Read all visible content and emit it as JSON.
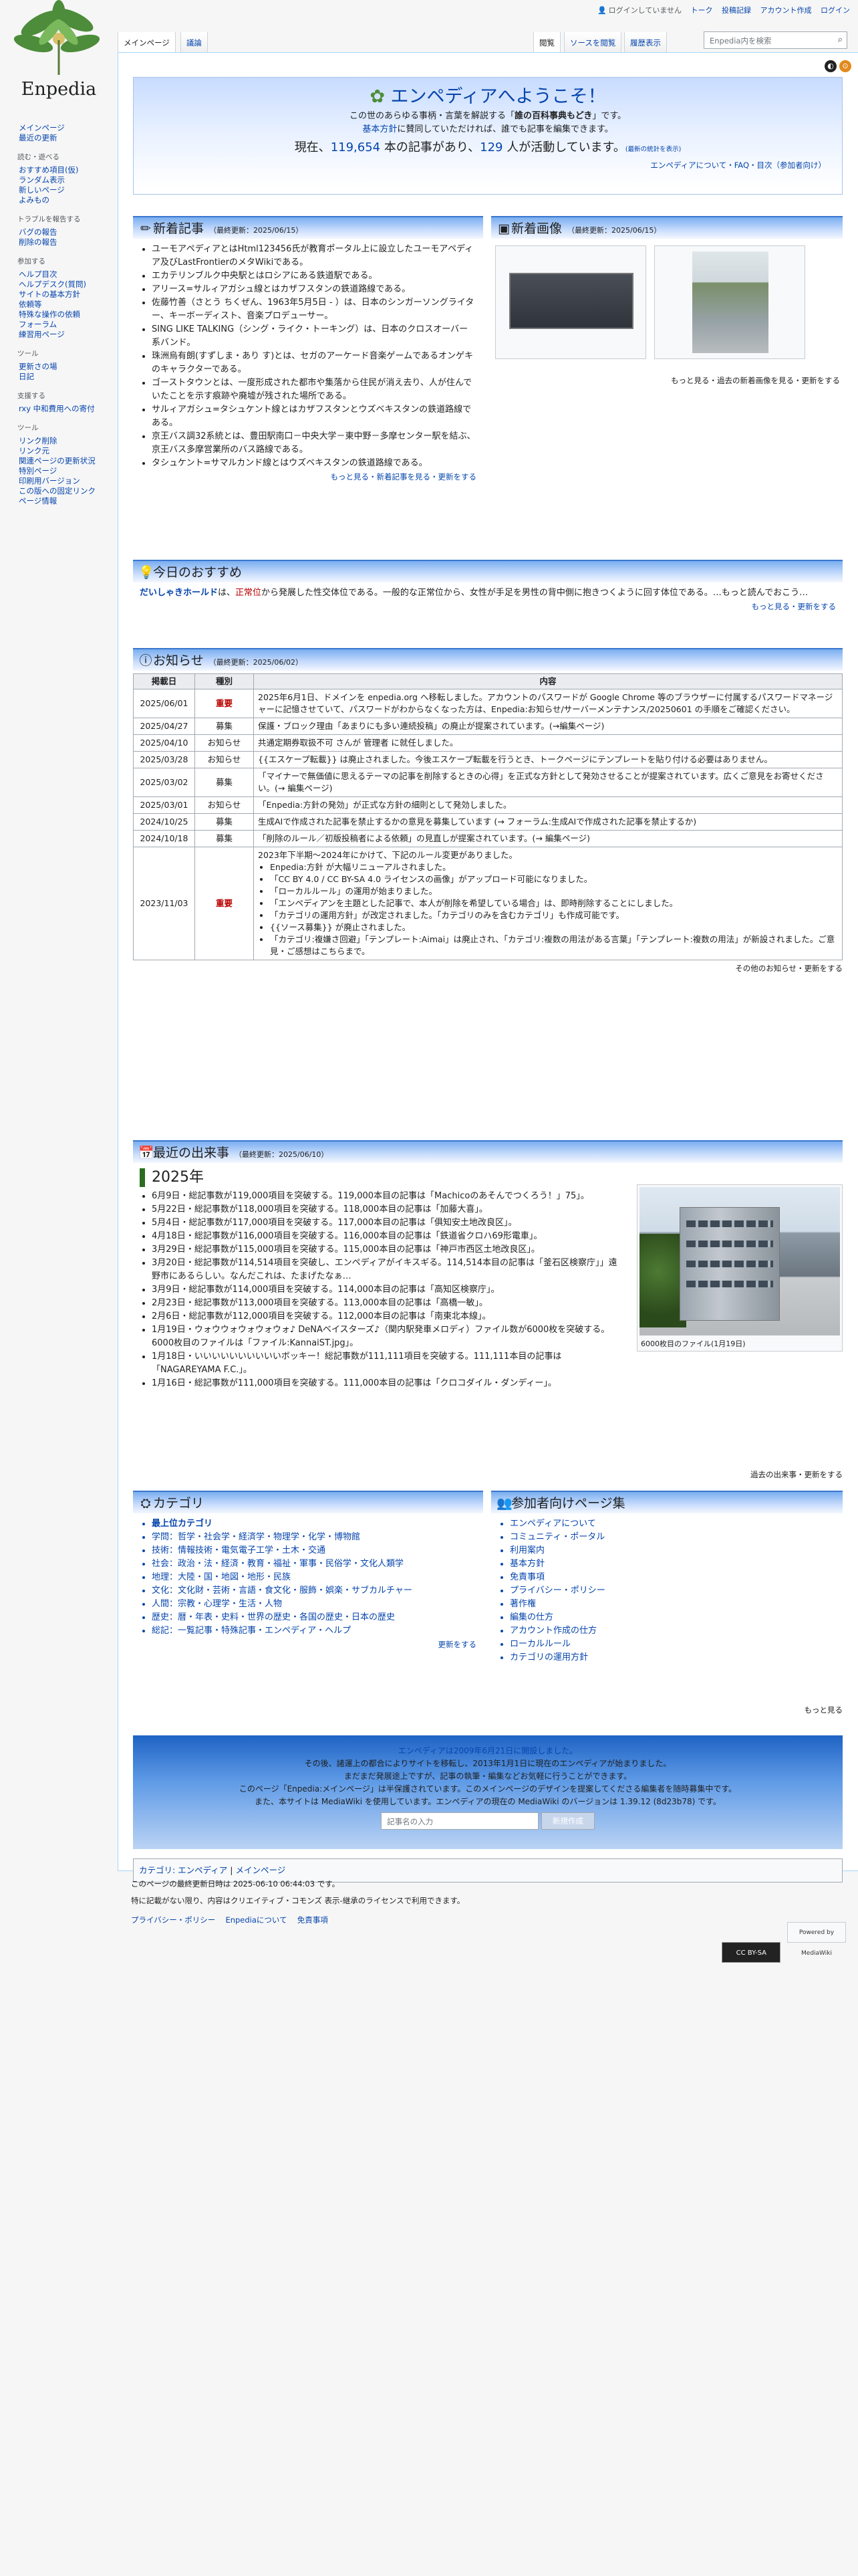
{
  "personal": {
    "user": "ログインしていません",
    "talk": "トーク",
    "contribs": "投稿記録",
    "create": "アカウント作成",
    "login": "ログイン"
  },
  "logo": {
    "wordmark": "Enpedia"
  },
  "tabs": {
    "main": "メインページ",
    "discussion": "議論",
    "read": "閲覧",
    "source": "ソースを閲覧",
    "history": "履歴表示"
  },
  "search": {
    "placeholder": "Enpedia内を検索"
  },
  "sidebar": [
    {
      "heading": "",
      "items": [
        "メインページ",
        "最近の更新"
      ]
    },
    {
      "heading": "読む・遊べる",
      "items": [
        "おすすめ項目(仮)",
        "ランダム表示",
        "新しいページ",
        "よみもの"
      ]
    },
    {
      "heading": "トラブルを報告する",
      "items": [
        "バグの報告",
        "削除の報告"
      ]
    },
    {
      "heading": "参加する",
      "items": [
        "ヘルプ目次",
        "ヘルプデスク(質問)",
        "サイトの基本方針",
        "依頼等",
        "特殊な操作の依頼",
        "フォーラム",
        "練習用ページ"
      ]
    },
    {
      "heading": "ツール",
      "items": [
        "更新さの場",
        "日記"
      ]
    },
    {
      "heading": "支援する",
      "items": [
        "rxy 中和費用への寄付"
      ]
    },
    {
      "heading": "ツール",
      "items": [
        "リンク削除",
        "リンク元",
        "関連ページの更新状況",
        "特別ページ",
        "印刷用バージョン",
        "この版への固定リンク",
        "ページ情報"
      ]
    }
  ],
  "welcome": {
    "title": "エンペディアへようこそ！",
    "line1a": "この世のあらゆる事柄・言葉を解説する「",
    "line1b": "誰の百科事典もどき",
    "line1c": "」です。",
    "line2a": "基本方針",
    "line2b": "に賛同していただければ、誰でも記事を編集できます。",
    "count_pre": "現在、",
    "articles": "119,654",
    "count_mid": " 本の記事があり、",
    "users": "129",
    "count_post": " 人が活動しています。",
    "count_note": "(最新の統計を表示)",
    "links": "エンペディアについて・FAQ・目次（参加者向け）"
  },
  "new_articles": {
    "title": "新着記事",
    "updated": "（最終更新：2025/06/15）",
    "items": [
      "ユーモアペディアとはHtml123456氏が教育ポータル上に設立したユーモアペディア及びLastFrontierのメタWikiである。",
      "エカテリンブルク中央駅とはロシアにある鉄道駅である。",
      "アリース=サルィアガシュ線とはカザフスタンの鉄道路線である。",
      "佐藤竹善（さとう ちくぜん、1963年5月5日 - ）は、日本のシンガーソングライター、キーボーディスト、音楽プロデューサー。",
      "SING LIKE TALKING（シング・ライク・トーキング）は、日本のクロスオーバー系バンド。",
      "珠洲烏有朗(すずしま・あり す)とは、セガのアーケード音楽ゲームであるオンゲキのキャラクターである。",
      "ゴーストタウンとは、一度形成された都市や集落から住民が消え去り、人が住んでいたことを示す痕跡や廃墟が残された場所である。",
      "サルィアガシュ=タシュケント線とはカザフスタンとウズベキスタンの鉄道路線である。",
      "京王バス調32系統とは、豊田駅南口－中央大学－東中野－多摩センター駅を結ぶ、京王バス多摩営業所のバス路線である。",
      "タシュケント=サマルカンド線とはウズベキスタンの鉄道路線である。"
    ],
    "more": "もっと見る・新着記事を見る・更新をする"
  },
  "new_images": {
    "title": "新着画像",
    "updated": "（最終更新：2025/06/15）",
    "more": "もっと見る・過去の新着画像を見る・更新をする"
  },
  "recommend": {
    "title": "今日のおすすめ",
    "text_a": "だいしゃきホールド",
    "text_b": "は、",
    "text_c": "正常位",
    "text_d": "から発展した性交体位である。一般的な正常位から、女性が手足を男性の背中側に抱きつくように回す体位である。…もっと読んでおこう…",
    "more": "もっと見る・更新をする"
  },
  "notices": {
    "title": "お知らせ",
    "updated": "（最終更新：2025/06/02）",
    "headers": [
      "掲載日",
      "種別",
      "内容"
    ],
    "rows": [
      {
        "date": "2025/06/01",
        "kind": "重要",
        "text": "2025年6月1日、ドメインを enpedia.org へ移転しました。アカウントのパスワードが Google Chrome 等のブラウザーに付属するパスワードマネージャーに記憶させていて、パスワードがわからなくなった方は、Enpedia:お知らせ/サーバーメンテナンス/20250601 の手順をご確認ください。"
      },
      {
        "date": "2025/04/27",
        "kind": "募集",
        "text": "保護・ブロック理由「あまりにも多い連続投稿」の廃止が提案されています。(→編集ページ)"
      },
      {
        "date": "2025/04/10",
        "kind": "お知らせ",
        "text": "共通定期券取扱不可 さんが 管理者 に就任しました。"
      },
      {
        "date": "2025/03/28",
        "kind": "お知らせ",
        "text": "{{エスケープ転載}} は廃止されました。今後エスケープ転載を行うとき、トークページにテンプレートを貼り付ける必要はありません。"
      },
      {
        "date": "2025/03/02",
        "kind": "募集",
        "text": "「マイナーで無価値に思えるテーマの記事を削除するときの心得」を正式な方針として発効させることが提案されています。広くご意見をお寄せください。(→ 編集ページ)"
      },
      {
        "date": "2025/03/01",
        "kind": "お知らせ",
        "text": "「Enpedia:方針の発効」が正式な方針の細則として発効しました。"
      },
      {
        "date": "2024/10/25",
        "kind": "募集",
        "text": "生成AIで作成された記事を禁止するかの意見を募集しています (→ フォーラム:生成AIで作成された記事を禁止するか)"
      },
      {
        "date": "2024/10/18",
        "kind": "募集",
        "text": "「削除のルール／初版投稿者による依頼」の見直しが提案されています。(→ 編集ページ)"
      }
    ],
    "big_row": {
      "date": "2023/11/03",
      "kind": "重要",
      "intro": "2023年下半期〜2024年にかけて、下記のルール変更がありました。",
      "items": [
        "Enpedia:方針 が大幅リニューアルされました。",
        "「CC BY 4.0 / CC BY-SA 4.0 ライセンスの画像」がアップロード可能になりました。",
        "「ローカルルール」の運用が始まりました。",
        "「エンペディアンを主題とした記事で、本人が削除を希望している場合」は、即時削除することにしました。",
        "「カテゴリの運用方針」が改定されました。「カテゴリのみを含むカテゴリ」も作成可能です。",
        "{{ソース募集}} が廃止されました。",
        "「カテゴリ:複嫌さ回避」「テンプレート:Aimai」は廃止され、「カテゴリ:複数の用法がある言葉」「テンプレート:複数の用法」が新設されました。ご意見・ご感想はこちらまで。"
      ]
    },
    "more": "その他のお知らせ・更新をする"
  },
  "recent": {
    "title": "最近の出来事",
    "updated": "（最終更新：2025/06/10）",
    "year": "2025年",
    "items": [
      "6月9日・総記事数が119,000項目を突破する。119,000本目の記事は「Machicoのあそんでつくろう！」75」。",
      "5月22日・総記事数が118,000項目を突破する。118,000本目の記事は「加藤大喜」。",
      "5月4日・総記事数が117,000項目を突破する。117,000本目の記事は「俱知安土地改良区」。",
      "4月18日・総記事数が116,000項目を突破する。116,000本目の記事は「鉄道省クロハ69形電車」。",
      "3月29日・総記事数が115,000項目を突破する。115,000本目の記事は「神戸市西区土地改良区」。",
      "3月20日・総記事数が114,514項目を突破し、エンペディアがイキスギる。114,514本目の記事は「釜石区検察庁」」遠野市にあるらしい。なんだこれは、たまげたなぁ…",
      "3月9日・総記事数が114,000項目を突破する。114,000本目の記事は「高知区検察庁」。",
      "2月23日・総記事数が113,000項目を突破する。113,000本目の記事は「高橋一敏」。",
      "2月6日・総記事数が112,000項目を突破する。112,000本目の記事は「南東北本線」。",
      "1月19日・ウォウウォウォウォウォ♪ DeNAベイスターズ♪（関内駅発車メロディ）ファイル数が6000枚を突破する。6000枚目のファイルは「ファイル:KannaiST.jpg」。",
      "1月18日・いいいいいいいいいいボッキー！総記事数が111,111項目を突破する。111,111本目の記事は「NAGAREYAMA F.C.」。",
      "1月16日・総記事数が111,000項目を突破する。111,000本目の記事は「クロコダイル・ダンディー」。"
    ],
    "caption": "6000枚目のファイル(1月19日)",
    "more": "過去の出来事・更新をする"
  },
  "categories": {
    "title": "カテゴリ",
    "rows": [
      "最上位カテゴリ",
      "学問：哲学・社会学・経済学・物理学・化学・博物館",
      "技術：情報技術・電気電子工学・土木・交通",
      "社会：政治・法・経済・教育・福祉・軍事・民俗学・文化人類学",
      "地理：大陸・国・地図・地形・民族",
      "文化：文化財・芸術・言語・食文化・服飾・娯楽・サブカルチャー",
      "人間：宗教・心理学・生活・人物",
      "歴史：暦・年表・史料・世界の歴史・各国の歴史・日本の歴史",
      "総記：一覧記事・特殊記事・エンペディア・ヘルプ"
    ],
    "more": "更新をする"
  },
  "participants": {
    "title": "参加者向けページ集",
    "items": [
      "エンペディアについて",
      "コミュニティ・ポータル",
      "利用案内",
      "基本方針",
      "免責事項",
      "プライバシー・ポリシー",
      "著作権",
      "編集の仕方",
      "アカウント作成の仕方",
      "ローカルルール",
      "カテゴリの運用方針"
    ],
    "more": "もっと見る"
  },
  "bottom": {
    "l1": "エンペディアは2009年6月21日に開設しました。",
    "l2": "その後、諸運上の都合によりサイトを移転し、2013年1月1日に現在のエンペディアが始まりました。",
    "l3": "まだまだ発展途上ですが、記事の執筆・編集などお気軽に行うことができます。",
    "l4": "このページ「Enpedia:メインページ」は半保護されています。このメインページのデザインを提案してくださる編集者を随時募集中です。",
    "l5": "また、本サイトは MediaWiki を使用しています。エンペディアの現在の MediaWiki のバージョンは 1.39.12 (8d23b78) です。",
    "input_placeholder": "記事名の入力",
    "button": "新規作成"
  },
  "catbar": {
    "label": "カテゴリ: エンペディア",
    "sep": " | ",
    "item": "メインページ"
  },
  "footer": {
    "lastmod": "このページの最終更新日時は 2025-06-10 06:44:03 です。",
    "license": "特に記載がない限り、内容はクリエイティブ・コモンズ 表示-継承のライセンスで利用できます。",
    "links": [
      "プライバシー・ポリシー",
      "Enpediaについて",
      "免責事項"
    ],
    "badge1": "CC BY-SA",
    "badge2": "Powered by MediaWiki"
  },
  "colors": {
    "link": "#0645ad",
    "red": "#ba0000",
    "header_blue": "#3a76cf"
  }
}
